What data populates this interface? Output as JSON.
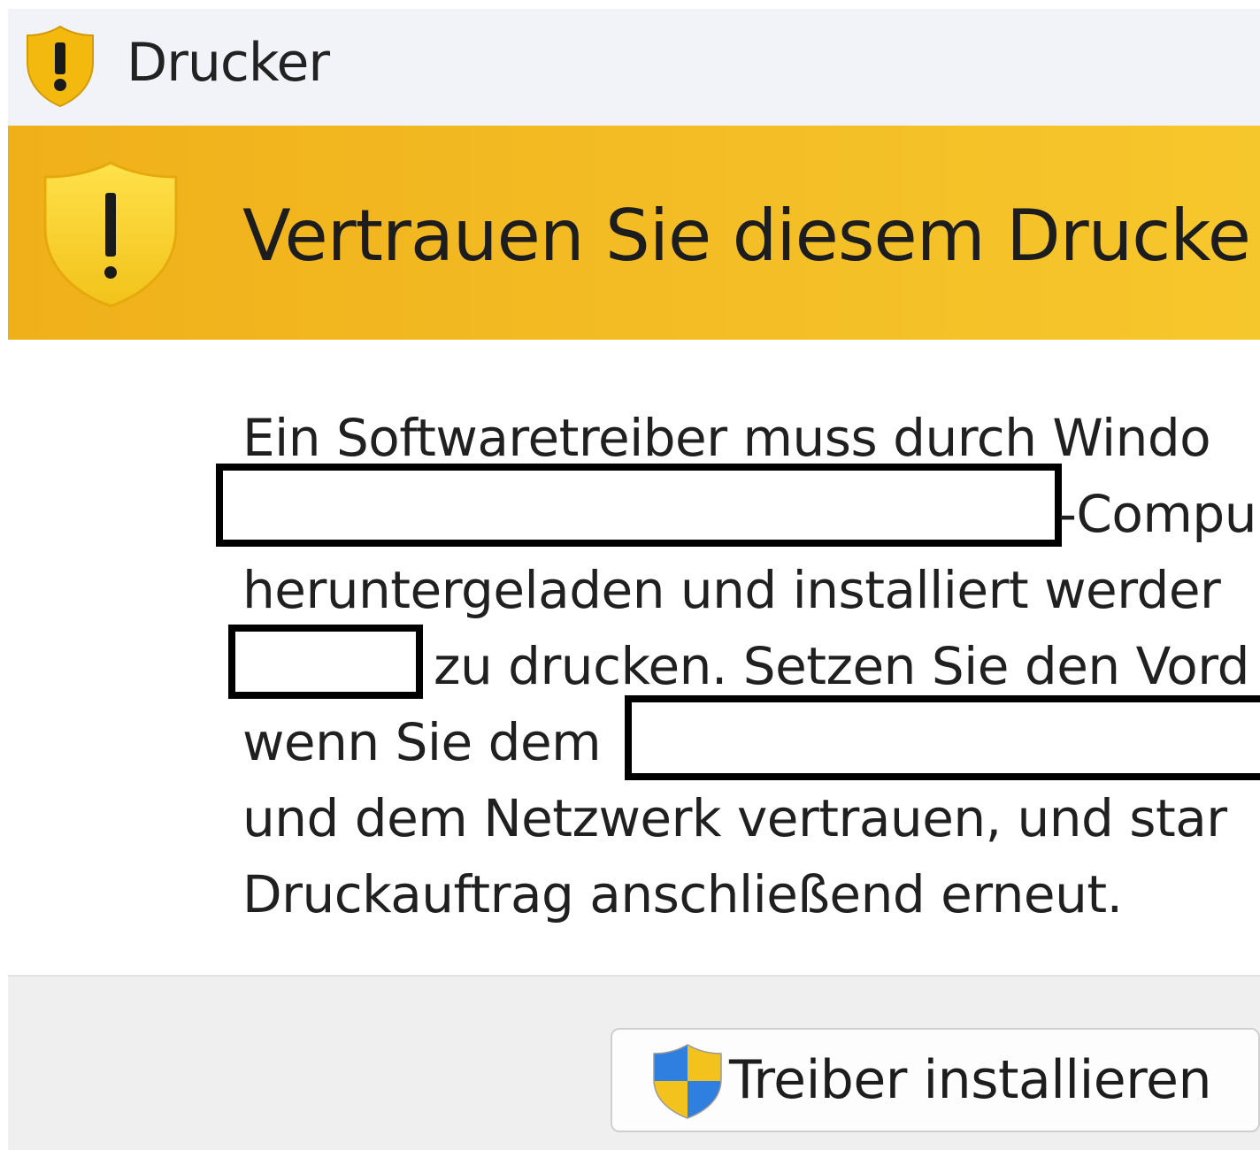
{
  "window": {
    "title": "Drucker",
    "title_icon": "shield-warning-icon"
  },
  "banner": {
    "heading": "Vertrauen Sie diesem Drucke",
    "icon": "shield-warning-icon",
    "color": "#f4be26"
  },
  "message": {
    "line1": "Ein Softwaretreiber muss durch Windo",
    "line2_after_redaction": "-Compu",
    "line3": "heruntergeladen und installiert werder",
    "line4_after_redaction": "zu drucken. Setzen Sie den Vord",
    "line5_before_redaction": "wenn Sie dem",
    "line6": "und dem Netzwerk vertrauen, und star",
    "line7": "Druckauftrag anschließend erneut."
  },
  "footer": {
    "install_button_label": "Treiber installieren",
    "install_button_icon": "uac-shield-icon"
  }
}
